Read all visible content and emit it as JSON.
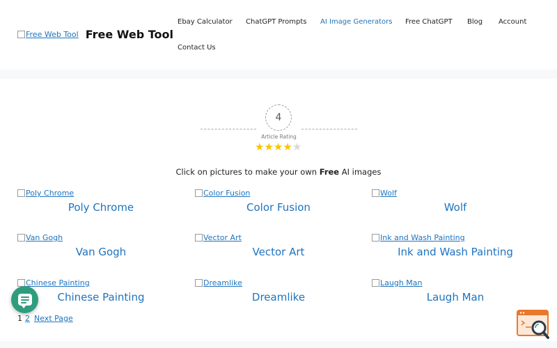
{
  "header": {
    "logo_alt": "Free Web Tool",
    "site_title": "Free Web Tool"
  },
  "nav": {
    "items": [
      {
        "label": "Ebay Calculator"
      },
      {
        "label": "ChatGPT Prompts"
      },
      {
        "label": "AI Image Generators"
      },
      {
        "label": "Free ChatGPT"
      },
      {
        "label": "Blog"
      },
      {
        "label": "Account"
      },
      {
        "label": "Contact Us"
      }
    ],
    "active_color": "#1e73be"
  },
  "rating": {
    "value": "4",
    "label": "Article Rating",
    "stars_filled": 4,
    "stars_total": 5,
    "star_color": "#f6c400"
  },
  "intro": {
    "before": "Click on pictures to make your own ",
    "bold": "Free",
    "after": " AI images"
  },
  "gallery": {
    "items": [
      {
        "alt": "Poly Chrome",
        "caption": "Poly Chrome"
      },
      {
        "alt": "Color Fusion",
        "caption": "Color Fusion"
      },
      {
        "alt": "Wolf",
        "caption": "Wolf"
      },
      {
        "alt": "Van Gogh",
        "caption": "Van Gogh"
      },
      {
        "alt": "Vector Art",
        "caption": "Vector Art"
      },
      {
        "alt": "Ink and Wash Painting",
        "caption": "Ink and Wash Painting"
      },
      {
        "alt": "Chinese Painting",
        "caption": "Chinese Painting"
      },
      {
        "alt": "Dreamlike",
        "caption": "Dreamlike"
      },
      {
        "alt": "Laugh Man",
        "caption": "Laugh Man"
      }
    ]
  },
  "pagination": {
    "current": "1",
    "page2": "2",
    "next": "Next Page"
  },
  "widgets": {
    "chat_icon": "chat-bubble-icon",
    "search_icon": "search-magnifier-icon",
    "chat_color": "#2e9d7d",
    "search_color": "#e8782c"
  }
}
